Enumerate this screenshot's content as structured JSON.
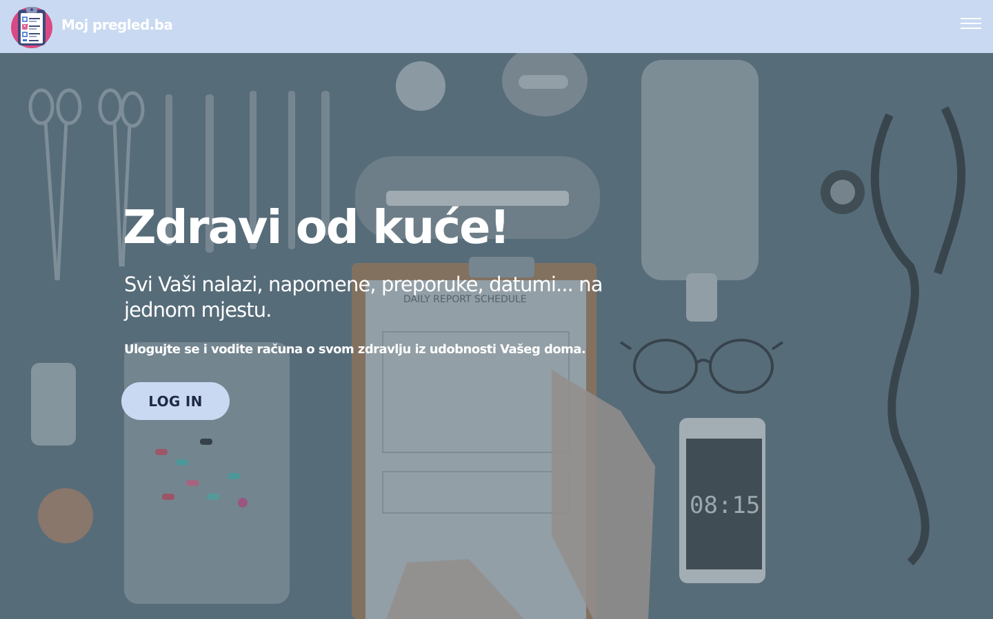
{
  "header": {
    "brand": "Moj pregled.ba",
    "logo_icon": "clipboard-checklist-icon",
    "menu_icon": "hamburger-menu-icon"
  },
  "hero": {
    "title": "Zdravi od kuće!",
    "subtitle": "Svi Vaši nalazi, napomene, preporuke, datumi... na jednom mjestu.",
    "text": "Ulogujte se i vodite računa o svom zdravlju iz udobnosti Vašeg doma.",
    "login_label": "LOG IN",
    "background": {
      "description_icon": "medical-desk-photo",
      "clipboard_heading": "DAILY REPORT SCHEDULE",
      "phone_time": "08:15"
    }
  },
  "colors": {
    "header_bg": "#c9d9f1",
    "button_bg": "#c9d9f1",
    "button_text": "#1f2a44",
    "hero_overlay": "#5f7480",
    "text": "#ffffff"
  }
}
